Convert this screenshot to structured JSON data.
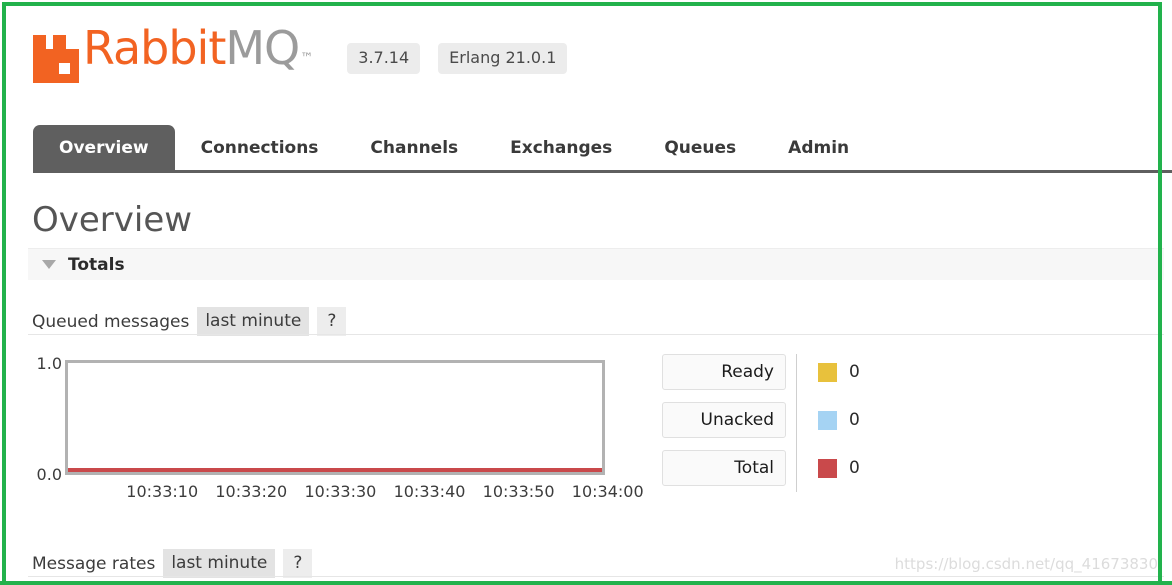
{
  "app": {
    "logo_text_primary": "Rabbit",
    "logo_text_secondary": "MQ",
    "logo_trademark": "™",
    "version": "3.7.14",
    "erlang_version": "Erlang 21.0.1"
  },
  "nav": {
    "tabs": [
      {
        "label": "Overview",
        "active": true
      },
      {
        "label": "Connections",
        "active": false
      },
      {
        "label": "Channels",
        "active": false
      },
      {
        "label": "Exchanges",
        "active": false
      },
      {
        "label": "Queues",
        "active": false
      },
      {
        "label": "Admin",
        "active": false
      }
    ]
  },
  "main": {
    "page_title": "Overview",
    "section": {
      "title": "Totals",
      "caret": "caret-down-icon",
      "expanded": true
    },
    "queued_messages": {
      "label": "Queued messages",
      "period": "last minute",
      "help": "?"
    },
    "message_rates": {
      "label": "Message rates",
      "period": "last minute",
      "help": "?"
    }
  },
  "chart_data": {
    "type": "line",
    "title": "Queued messages",
    "subtitle": "last minute",
    "xlabel": "",
    "ylabel": "",
    "ylim": [
      0.0,
      1.0
    ],
    "ytick_labels": [
      "1.0",
      "0.0"
    ],
    "grid": false,
    "legend_position": "right",
    "x": [
      "10:33:10",
      "10:33:20",
      "10:33:30",
      "10:33:40",
      "10:33:50",
      "10:34:00"
    ],
    "series": [
      {
        "name": "Ready",
        "color": "#e8c13c",
        "value": "0",
        "values": [
          0,
          0,
          0,
          0,
          0,
          0
        ]
      },
      {
        "name": "Unacked",
        "color": "#a5d3f3",
        "value": "0",
        "values": [
          0,
          0,
          0,
          0,
          0,
          0
        ]
      },
      {
        "name": "Total",
        "color": "#c9494b",
        "value": "0",
        "values": [
          0,
          0,
          0,
          0,
          0,
          0
        ]
      }
    ]
  },
  "watermark": "https://blog.csdn.net/qq_41673830",
  "colors": {
    "brand_orange": "#f26322",
    "brand_gray": "#9b9b9b",
    "active_tab": "#5f5f5f",
    "annotation_border": "#22b24c",
    "series_ready": "#e8c13c",
    "series_unacked": "#a5d3f3",
    "series_total": "#c9494b"
  }
}
